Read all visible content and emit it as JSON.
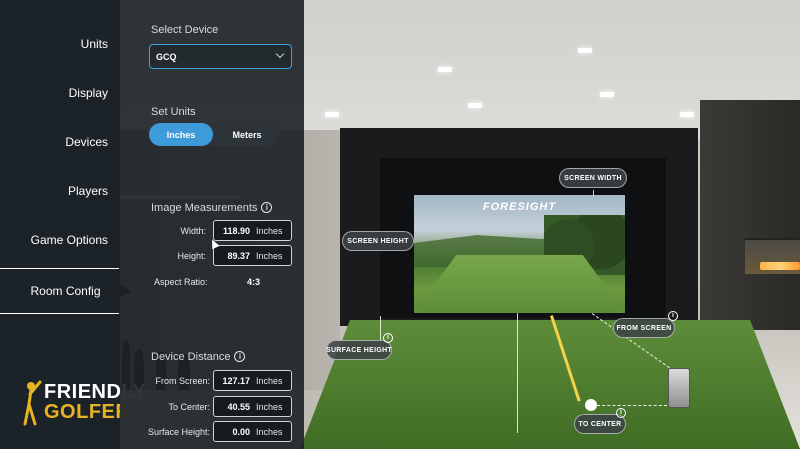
{
  "nav": {
    "items": [
      "Units",
      "Display",
      "Devices",
      "Players",
      "Game Options",
      "Room Config"
    ],
    "active": "Room Config"
  },
  "brand": {
    "line1": "FRIENDLY",
    "line2": "GOLFER"
  },
  "panel": {
    "select_device_label": "Select Device",
    "device_value": "GCQ",
    "set_units_label": "Set Units",
    "units_options": [
      "Inches",
      "Meters"
    ],
    "units_selected": "Inches",
    "image_measurements_label": "Image Measurements",
    "width_label": "Width:",
    "width_value": "118.90",
    "height_label": "Height:",
    "height_value": "89.37",
    "aspect_label": "Aspect Ratio:",
    "aspect_value": "4:3",
    "device_distance_label": "Device Distance",
    "from_screen_label": "From Screen:",
    "from_screen_value": "127.17",
    "to_center_label": "To Center:",
    "to_center_value": "40.55",
    "surface_height_label": "Surface Height:",
    "surface_height_value": "0.00",
    "unit": "Inches",
    "info_glyph": "i"
  },
  "scene": {
    "screen_logo": "FORESIGHT",
    "tags": {
      "screen_width": "SCREEN WIDTH",
      "screen_height": "SCREEN HEIGHT",
      "from_screen": "FROM SCREEN",
      "surface_height": "SURFACE HEIGHT",
      "to_center": "TO CENTER"
    }
  },
  "colors": {
    "accent": "#3d9bd9",
    "panel": "#1c2125",
    "brand_gold": "#e8b323"
  }
}
